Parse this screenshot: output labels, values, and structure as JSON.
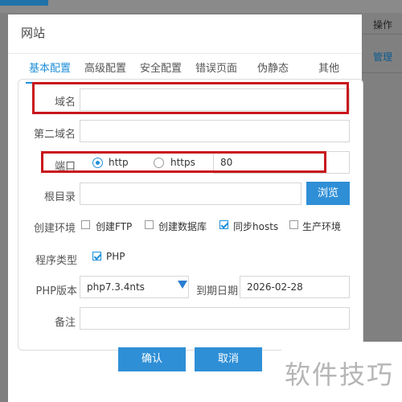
{
  "background": {
    "header_op": "操作",
    "manage_link": "管理"
  },
  "modal": {
    "title": "网站",
    "tabs": [
      "基本配置",
      "高级配置",
      "安全配置",
      "错误页面",
      "伪静态",
      "其他"
    ],
    "active_tab_index": 0
  },
  "form": {
    "domain": {
      "label": "域名",
      "value": ""
    },
    "second_domain": {
      "label": "第二域名",
      "value": ""
    },
    "port": {
      "label": "端口",
      "http_label": "http",
      "https_label": "https",
      "selected": "http",
      "value": "80"
    },
    "root_dir": {
      "label": "根目录",
      "value": "",
      "browse_label": "浏览"
    },
    "env": {
      "label": "创建环境",
      "options": [
        {
          "label": "创建FTP",
          "checked": false
        },
        {
          "label": "创建数据库",
          "checked": false
        },
        {
          "label": "同步hosts",
          "checked": true
        },
        {
          "label": "生产环境",
          "checked": false
        }
      ]
    },
    "program_type": {
      "label": "程序类型",
      "options": [
        {
          "label": "PHP",
          "checked": true
        }
      ]
    },
    "php_version": {
      "label": "PHP版本",
      "value": "php7.3.4nts"
    },
    "expire_date": {
      "label": "到期日期",
      "value": "2026-02-28"
    },
    "remark": {
      "label": "备注",
      "value": ""
    }
  },
  "buttons": {
    "confirm": "确认",
    "cancel": "取消"
  },
  "watermark": "软件技巧",
  "colors": {
    "accent": "#1e8fd8",
    "button": "#2f8fd6",
    "highlight_box": "#c8161d",
    "overlay": "#7f7f7f"
  }
}
